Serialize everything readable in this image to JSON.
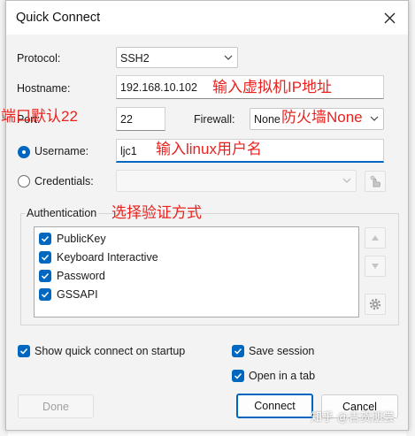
{
  "dialog": {
    "title": "Quick Connect"
  },
  "form": {
    "protocol_label": "Protocol:",
    "protocol_value": "SSH2",
    "hostname_label": "Hostname:",
    "hostname_value": "192.168.10.102",
    "port_label": "Port:",
    "port_value": "22",
    "firewall_label": "Firewall:",
    "firewall_value": "None",
    "username_label": "Username:",
    "username_value": "ljc1",
    "credentials_label": "Credentials:",
    "credentials_value": ""
  },
  "authentication": {
    "label": "Authentication",
    "methods": [
      {
        "label": "PublicKey",
        "checked": true
      },
      {
        "label": "Keyboard Interactive",
        "checked": true
      },
      {
        "label": "Password",
        "checked": true
      },
      {
        "label": "GSSAPI",
        "checked": true
      }
    ]
  },
  "options": {
    "show_quick_connect": "Show quick connect on startup",
    "save_session": "Save session",
    "open_in_tab": "Open in a tab"
  },
  "buttons": {
    "done": "Done",
    "connect": "Connect",
    "cancel": "Cancel"
  },
  "annotations": {
    "hostname_note": "输入虚拟机IP地址",
    "port_note": "端口默认22",
    "firewall_note": "防火墙None",
    "username_note": "输入linux用户名",
    "auth_note": "选择验证方式"
  },
  "watermark": "知乎 @吉贺朋尝",
  "colors": {
    "accent": "#0067c0",
    "annotation": "#e8231f",
    "dialog_bg": "#f3f3f3"
  }
}
